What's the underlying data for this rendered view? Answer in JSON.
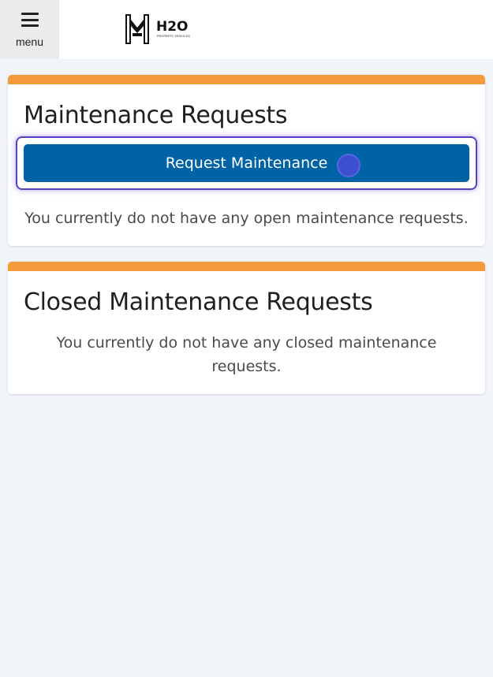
{
  "header": {
    "menu_label": "menu",
    "logo_text": "H2O",
    "logo_subtext": "PROPERTY SERVICES"
  },
  "open_section": {
    "title": "Maintenance Requests",
    "button_label": "Request Maintenance",
    "empty_message": "You currently do not have any open maintenance requests."
  },
  "closed_section": {
    "title": "Closed Maintenance Requests",
    "empty_message": "You currently do not have any closed maintenance requests."
  },
  "colors": {
    "accent": "#f59a3a",
    "primary_button": "#0063a6",
    "background": "#f1f5f9"
  },
  "icons": {
    "menu": "hamburger-icon",
    "logo": "h2o-logo"
  }
}
